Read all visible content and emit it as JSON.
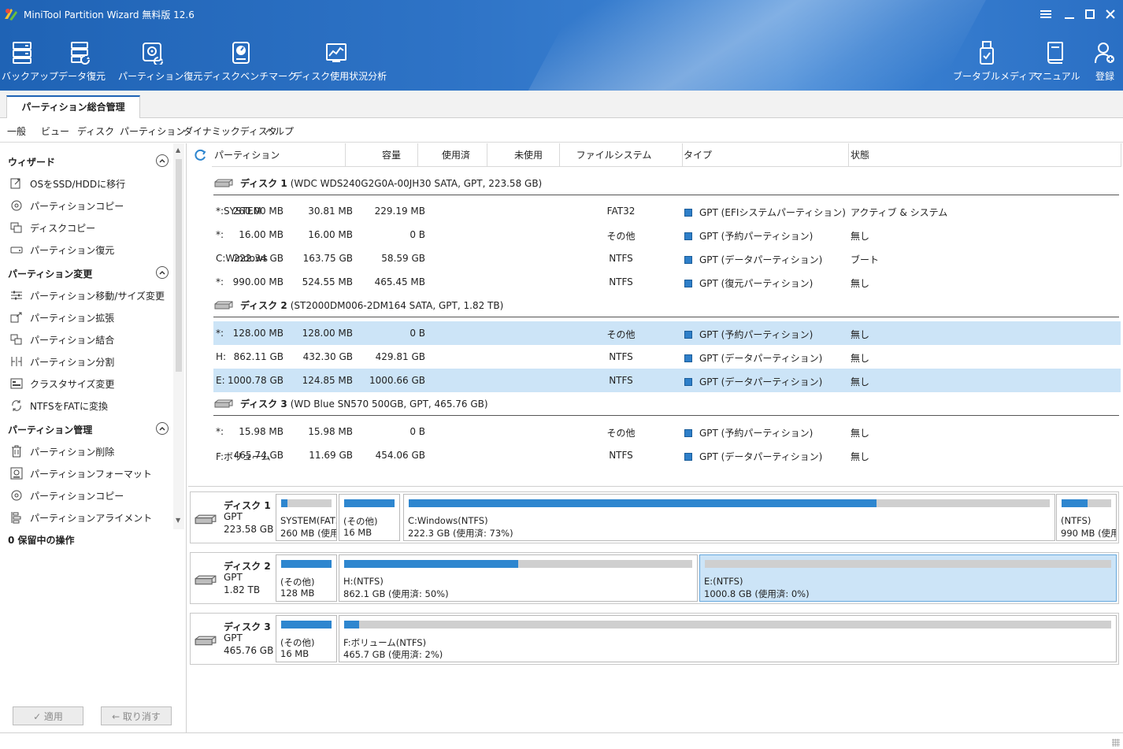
{
  "window": {
    "title": "MiniTool Partition Wizard 無料版 12.6"
  },
  "toolbar": {
    "left": [
      {
        "label": "バックアップ",
        "icon": "backup-icon"
      },
      {
        "label": "データ復元",
        "icon": "data-recovery-icon"
      },
      {
        "label": "パーティション復元",
        "icon": "partition-recovery-icon"
      },
      {
        "label": "ディスクベンチマーク",
        "icon": "disk-benchmark-icon"
      },
      {
        "label": "ディスク使用状況分析",
        "icon": "space-analyzer-icon"
      }
    ],
    "right": [
      {
        "label": "ブータブルメディア",
        "icon": "bootable-media-icon"
      },
      {
        "label": "マニュアル",
        "icon": "manual-icon"
      },
      {
        "label": "登録",
        "icon": "register-icon"
      }
    ]
  },
  "tabs": {
    "active": "パーティション総合管理"
  },
  "menu": [
    "一般",
    "ビュー",
    "ディスク",
    "パーティション",
    "ダイナミックディスク",
    "ヘルプ"
  ],
  "sidebar": {
    "sections": [
      {
        "title": "ウィザード",
        "items": [
          "OSをSSD/HDDに移行",
          "パーティションコピー",
          "ディスクコピー",
          "パーティション復元"
        ]
      },
      {
        "title": "パーティション変更",
        "items": [
          "パーティション移動/サイズ変更",
          "パーティション拡張",
          "パーティション結合",
          "パーティション分割",
          "クラスタサイズ変更",
          "NTFSをFATに変換"
        ]
      },
      {
        "title": "パーティション管理",
        "items": [
          "パーティション削除",
          "パーティションフォーマット",
          "パーティションコピー",
          "パーティションアライメント"
        ]
      }
    ],
    "pending": "0 保留中の操作",
    "apply": "✓ 適用",
    "undo": "← 取り消す"
  },
  "table": {
    "columns": [
      "パーティション",
      "容量",
      "使用済",
      "未使用",
      "ファイルシステム",
      "タイプ",
      "状態"
    ],
    "disks": [
      {
        "name": "ディスク 1",
        "desc": "(WDC WDS240G2G0A-00JH30 SATA, GPT, 223.58 GB)",
        "rows": [
          {
            "name": "*:SYSTEM",
            "cap": "260.00 MB",
            "used": "30.81 MB",
            "free": "229.19 MB",
            "fs": "FAT32",
            "type": "GPT (EFIシステムパーティション)",
            "status": "アクティブ & システム",
            "selected": false
          },
          {
            "name": "*:",
            "cap": "16.00 MB",
            "used": "16.00 MB",
            "free": "0 B",
            "fs": "その他",
            "type": "GPT (予約パーティション)",
            "status": "無し",
            "selected": false
          },
          {
            "name": "C:Windows",
            "cap": "222.34 GB",
            "used": "163.75 GB",
            "free": "58.59 GB",
            "fs": "NTFS",
            "type": "GPT (データパーティション)",
            "status": "ブート",
            "selected": false
          },
          {
            "name": "*:",
            "cap": "990.00 MB",
            "used": "524.55 MB",
            "free": "465.45 MB",
            "fs": "NTFS",
            "type": "GPT (復元パーティション)",
            "status": "無し",
            "selected": false
          }
        ]
      },
      {
        "name": "ディスク 2",
        "desc": "(ST2000DM006-2DM164 SATA, GPT, 1.82 TB)",
        "rows": [
          {
            "name": "*:",
            "cap": "128.00 MB",
            "used": "128.00 MB",
            "free": "0 B",
            "fs": "その他",
            "type": "GPT (予約パーティション)",
            "status": "無し",
            "selected": true
          },
          {
            "name": "H:",
            "cap": "862.11 GB",
            "used": "432.30 GB",
            "free": "429.81 GB",
            "fs": "NTFS",
            "type": "GPT (データパーティション)",
            "status": "無し",
            "selected": false
          },
          {
            "name": "E:",
            "cap": "1000.78 GB",
            "used": "124.85 MB",
            "free": "1000.66 GB",
            "fs": "NTFS",
            "type": "GPT (データパーティション)",
            "status": "無し",
            "selected": true
          }
        ]
      },
      {
        "name": "ディスク 3",
        "desc": "(WD Blue SN570 500GB, GPT, 465.76 GB)",
        "rows": [
          {
            "name": "*:",
            "cap": "15.98 MB",
            "used": "15.98 MB",
            "free": "0 B",
            "fs": "その他",
            "type": "GPT (予約パーティション)",
            "status": "無し",
            "selected": false
          },
          {
            "name": "F:ボリューム",
            "cap": "465.74 GB",
            "used": "11.69 GB",
            "free": "454.06 GB",
            "fs": "NTFS",
            "type": "GPT (データパーティション)",
            "status": "無し",
            "selected": false
          }
        ]
      }
    ]
  },
  "diskmap": [
    {
      "name": "ディスク 1",
      "style": "GPT",
      "size": "223.58 GB",
      "parts": [
        {
          "l1": "SYSTEM(FAT3",
          "l2": "260 MB (使用",
          "used_fraction": 0.12,
          "selected": false
        },
        {
          "l1": "(その他)",
          "l2": "16 MB",
          "used_fraction": 1.0,
          "selected": false
        },
        {
          "l1": "C:Windows(NTFS)",
          "l2": "222.3 GB (使用済: 73%)",
          "used_fraction": 0.73,
          "selected": false
        },
        {
          "l1": "(NTFS)",
          "l2": "990 MB (使用",
          "used_fraction": 0.53,
          "selected": false
        }
      ]
    },
    {
      "name": "ディスク 2",
      "style": "GPT",
      "size": "1.82 TB",
      "parts": [
        {
          "l1": "(その他)",
          "l2": "128 MB",
          "used_fraction": 1.0,
          "selected": false
        },
        {
          "l1": "H:(NTFS)",
          "l2": "862.1 GB (使用済: 50%)",
          "used_fraction": 0.5,
          "selected": false
        },
        {
          "l1": "E:(NTFS)",
          "l2": "1000.8 GB (使用済: 0%)",
          "used_fraction": 0.0,
          "selected": true
        }
      ]
    },
    {
      "name": "ディスク 3",
      "style": "GPT",
      "size": "465.76 GB",
      "parts": [
        {
          "l1": "(その他)",
          "l2": "16 MB",
          "used_fraction": 1.0,
          "selected": false
        },
        {
          "l1": "F:ボリューム(NTFS)",
          "l2": "465.7 GB (使用済: 2%)",
          "used_fraction": 0.02,
          "selected": false
        }
      ]
    }
  ]
}
